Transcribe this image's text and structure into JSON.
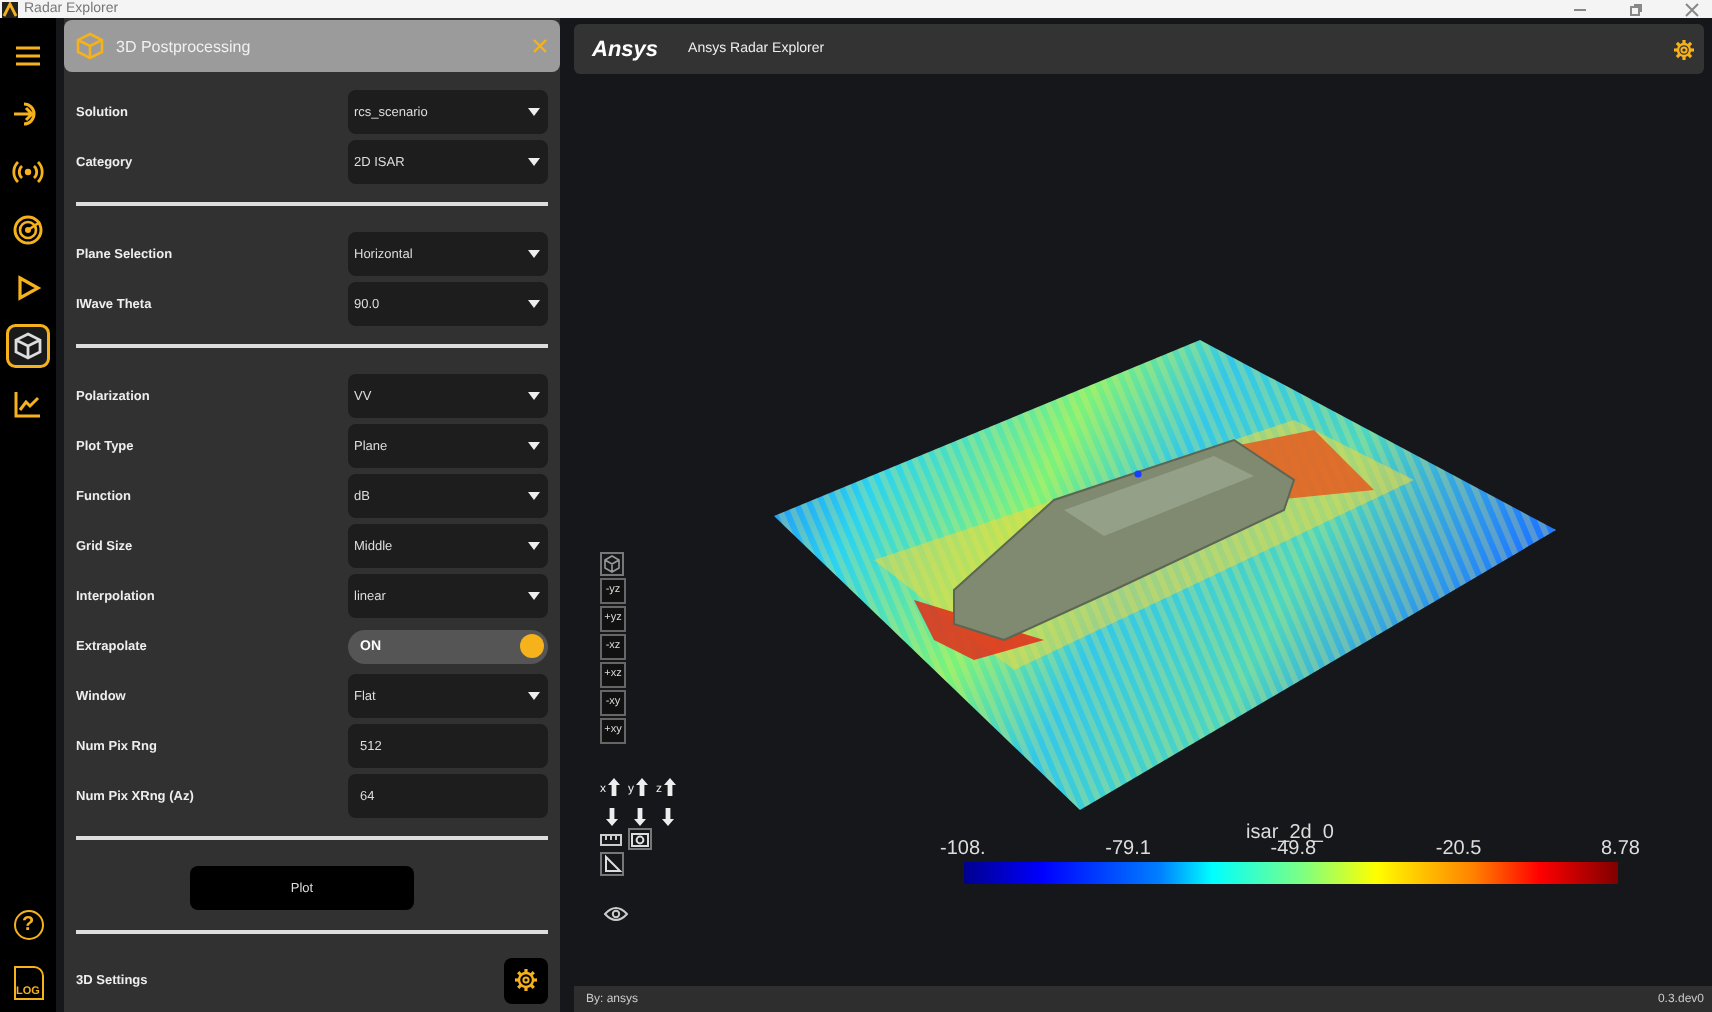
{
  "window": {
    "title": "Radar Explorer"
  },
  "nav": {
    "top": [
      {
        "selected": false
      },
      {
        "selected": false
      },
      {
        "selected": false
      },
      {
        "selected": false
      },
      {
        "selected": false
      },
      {
        "selected": true
      },
      {
        "selected": false
      }
    ],
    "bottom": [
      {
        "label": "?",
        "selected": false
      },
      {
        "label": "LOG",
        "selected": false
      }
    ]
  },
  "panel": {
    "title": "3D Postprocessing",
    "rows": [
      {
        "kind": "select",
        "label": "Solution",
        "value": "rcs_scenario"
      },
      {
        "kind": "select",
        "label": "Category",
        "value": "2D ISAR"
      },
      {
        "kind": "divider"
      },
      {
        "kind": "select",
        "label": "Plane Selection",
        "value": "Horizontal"
      },
      {
        "kind": "select",
        "label": "IWave Theta",
        "value": "90.0"
      },
      {
        "kind": "divider"
      },
      {
        "kind": "select",
        "label": "Polarization",
        "value": "VV"
      },
      {
        "kind": "select",
        "label": "Plot Type",
        "value": "Plane"
      },
      {
        "kind": "select",
        "label": "Function",
        "value": "dB"
      },
      {
        "kind": "select",
        "label": "Grid Size",
        "value": "Middle"
      },
      {
        "kind": "select",
        "label": "Interpolation",
        "value": "linear"
      },
      {
        "kind": "toggle",
        "label": "Extrapolate",
        "value": "ON",
        "on": true
      },
      {
        "kind": "select",
        "label": "Window",
        "value": "Flat"
      },
      {
        "kind": "input",
        "label": "Num Pix Rng",
        "value": "512"
      },
      {
        "kind": "input",
        "label": "Num Pix XRng (Az)",
        "value": "64"
      },
      {
        "kind": "divider"
      },
      {
        "kind": "button",
        "label": "Plot"
      },
      {
        "kind": "divider"
      },
      {
        "kind": "settings",
        "label": "3D Settings"
      }
    ]
  },
  "header": {
    "logo": "Ansys",
    "title": "Ansys Radar Explorer"
  },
  "view_buttons": [
    "-yz",
    "+yz",
    "-xz",
    "+xz",
    "-xy",
    "+xy"
  ],
  "axis_labels": [
    "x",
    "y",
    "z"
  ],
  "colorbar": {
    "title": "isar_2d_0",
    "ticks": [
      "-108.",
      "-79.1",
      "-49.8",
      "-20.5",
      "8.78"
    ]
  },
  "status_bar": {
    "left": "By: ansys",
    "right": "0.3.dev0"
  }
}
